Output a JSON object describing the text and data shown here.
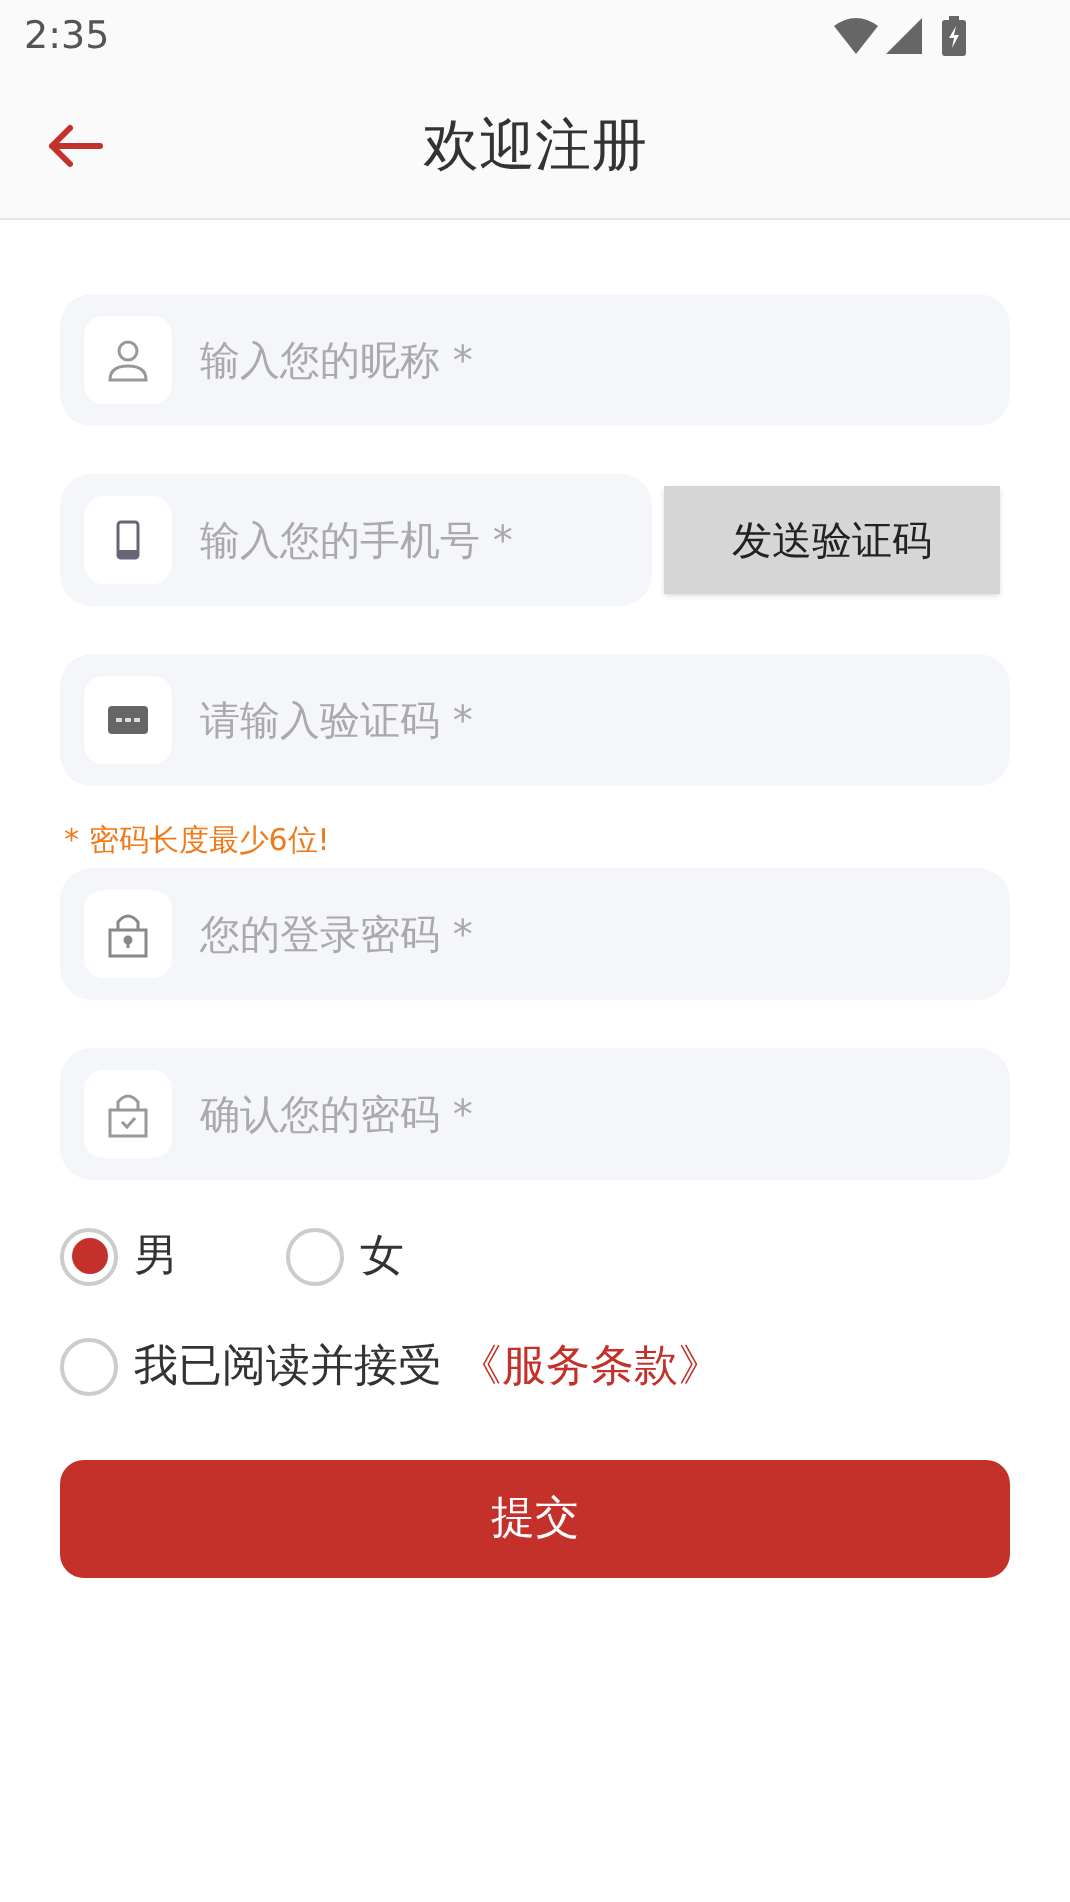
{
  "status_bar": {
    "time": "2:35"
  },
  "header": {
    "title": "欢迎注册"
  },
  "fields": [
    {
      "kind": "user",
      "placeholder": "输入您的昵称 *"
    },
    {
      "kind": "phone",
      "placeholder": "输入您的手机号 *",
      "button": "发送验证码"
    },
    {
      "kind": "code",
      "placeholder": "请输入验证码 *"
    },
    {
      "kind": "lock",
      "placeholder": "您的登录密码 *",
      "note": "* 密码长度最少6位!"
    },
    {
      "kind": "lock_check",
      "placeholder": "确认您的密码 *"
    }
  ],
  "gender": [
    {
      "label": "男",
      "selected": true
    },
    {
      "label": "女",
      "selected": false
    }
  ],
  "agreement": {
    "checked": false,
    "text": "我已阅读并接受",
    "link": "《服务条款》"
  },
  "submit": "提交"
}
